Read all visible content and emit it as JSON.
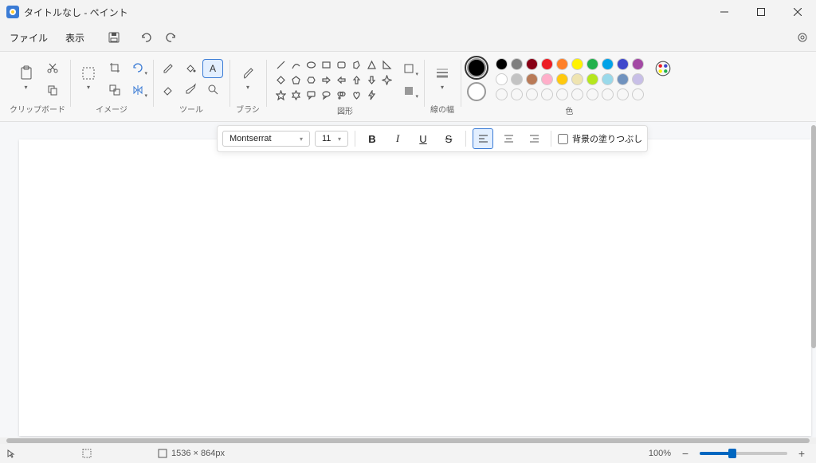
{
  "titlebar": {
    "title": "タイトルなし - ペイント"
  },
  "menu": {
    "file": "ファイル",
    "view": "表示"
  },
  "groups": {
    "clipboard": "クリップボード",
    "image": "イメージ",
    "tools": "ツール",
    "brush": "ブラシ",
    "shapes": "図形",
    "line": "線の幅",
    "color": "色"
  },
  "text_toolbar": {
    "font": "Montserrat",
    "size": "11",
    "bold": "B",
    "fill_bg_label": "背景の塗りつぶし"
  },
  "colors": {
    "primary": "#000000",
    "secondary": "#ffffff",
    "row1": [
      "#000000",
      "#7f7f7f",
      "#880015",
      "#ed1c24",
      "#ff7f27",
      "#fff200",
      "#22b14c",
      "#00a2e8",
      "#3f48cc",
      "#a349a4"
    ],
    "row2": [
      "#ffffff",
      "#c3c3c3",
      "#b97a57",
      "#ffaec9",
      "#ffc90e",
      "#efe4b0",
      "#b5e61d",
      "#99d9ea",
      "#7092be",
      "#c8bfe7"
    ]
  },
  "status": {
    "cursor": "",
    "selection": "",
    "size": "1536 × 864px",
    "zoom": "100%"
  }
}
